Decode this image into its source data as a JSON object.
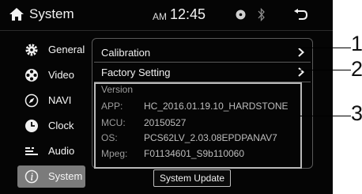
{
  "header": {
    "title": "System",
    "ampm": "AM",
    "time": "12:45",
    "icons": [
      "home-icon",
      "disc-icon",
      "bluetooth-icon",
      "back-icon"
    ]
  },
  "sidebar": {
    "items": [
      {
        "label": "General",
        "icon": "gear-icon",
        "active": false
      },
      {
        "label": "Video",
        "icon": "film-reel-icon",
        "active": false
      },
      {
        "label": "NAVI",
        "icon": "compass-icon",
        "active": false
      },
      {
        "label": "Clock",
        "icon": "clock-icon",
        "active": false
      },
      {
        "label": "Audio",
        "icon": "equalizer-icon",
        "active": false
      },
      {
        "label": "System",
        "icon": "info-icon",
        "active": true
      }
    ]
  },
  "main": {
    "rows": [
      {
        "label": "Calibration"
      },
      {
        "label": "Factory Setting"
      }
    ],
    "version": {
      "title": "Version",
      "entries": [
        {
          "key": "APP:",
          "value": "HC_2016.01.19.10_HARDSTONE"
        },
        {
          "key": "MCU:",
          "value": "20150527"
        },
        {
          "key": "OS:",
          "value": "PCS62LV_2.03.08EPDPANAV7"
        },
        {
          "key": "Mpeg:",
          "value": "F01134601_S9b110060"
        }
      ]
    },
    "update_button": "System Update"
  },
  "callouts": [
    "1",
    "2",
    "3"
  ]
}
